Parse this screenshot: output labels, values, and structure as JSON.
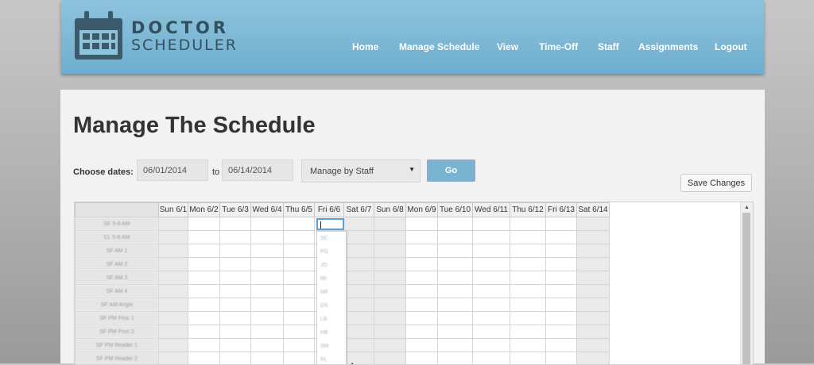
{
  "app": {
    "logo_line1": "DOCTOR",
    "logo_line2": "SCHEDULER",
    "logo_icon": "calendar-icon"
  },
  "nav": {
    "items": [
      "Home",
      "Manage Schedule",
      "View",
      "Time-Off",
      "Staff",
      "Assignments",
      "Logout"
    ]
  },
  "page": {
    "title": "Manage The Schedule",
    "choose_label": "Choose dates:",
    "start_date": "06/01/2014",
    "to_label": "to",
    "end_date": "06/14/2014",
    "manage_select": "Manage by Staff",
    "go_label": "Go",
    "save_label": "Save Changes"
  },
  "grid": {
    "days": [
      "Sun 6/1",
      "Mon 6/2",
      "Tue 6/3",
      "Wed 6/4",
      "Thu 6/5",
      "Fri 6/6",
      "Sat 6/7",
      "Sun 6/8",
      "Mon 6/9",
      "Tue 6/10",
      "Wed 6/11",
      "Thu 6/12",
      "Fri 6/13",
      "Sat 6/14"
    ],
    "weekend_cols": [
      0,
      6,
      7,
      13
    ],
    "row_labels": [
      "SF 5-8 AM",
      "CL 5-8 AM",
      "SF AM 1",
      "SF AM 2",
      "SF AM 3",
      "SF AM 4",
      "SF AM Angio",
      "SF PM Proc 1",
      "SF PM Proc 2",
      "SF PM Reader 1",
      "SF PM Reader 2"
    ],
    "active_cell_value": "",
    "dropdown_options": [
      "SC",
      "PG",
      "JD",
      "MI",
      "MF",
      "DS",
      "LB",
      "HB",
      "SM",
      "RL"
    ]
  },
  "colors": {
    "header_bg": "#7fb9d6",
    "accent_button": "#7ab3cf",
    "focus_border": "#5b9fd6"
  }
}
